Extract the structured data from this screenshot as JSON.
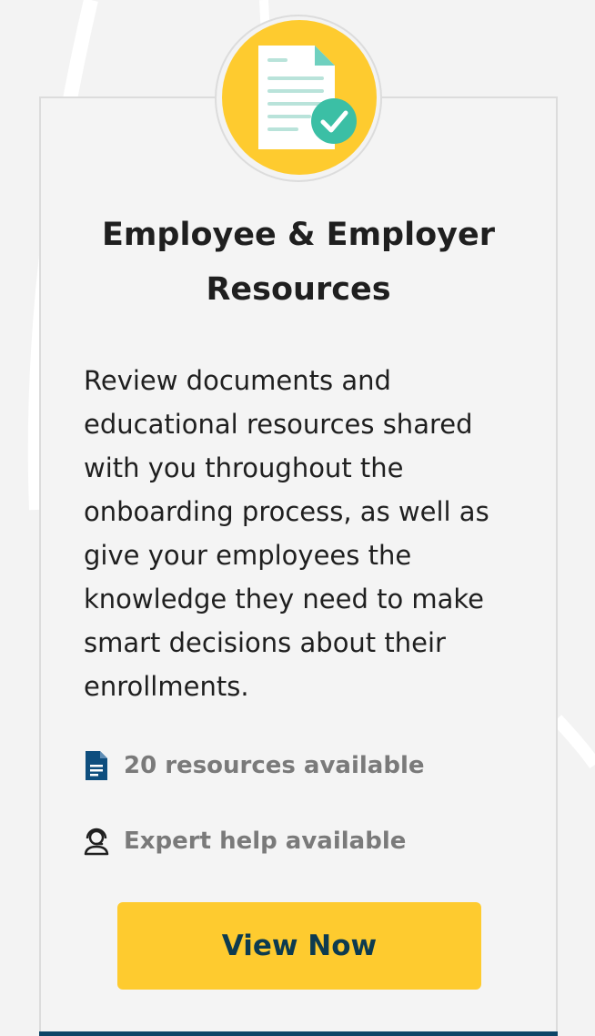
{
  "card": {
    "title": "Employee & Employer Resources",
    "description": "Review documents and educational resources shared with you throughout the onboarding process, as well as give your employees the knowledge they need to make smart decisions about their enrollments.",
    "meta": [
      {
        "icon": "document-icon",
        "text": "20 resources available"
      },
      {
        "icon": "support-agent-icon",
        "text": "Expert help available"
      }
    ],
    "cta_label": "View Now",
    "badge_icon": "document-check-icon"
  },
  "colors": {
    "accent": "#fecb2f",
    "button_text": "#0d3b4f",
    "icon_blue": "#0e4e7e",
    "check_green": "#3bbfa5",
    "background": "#f3f3f3",
    "bottom_bar": "#0e4466"
  }
}
